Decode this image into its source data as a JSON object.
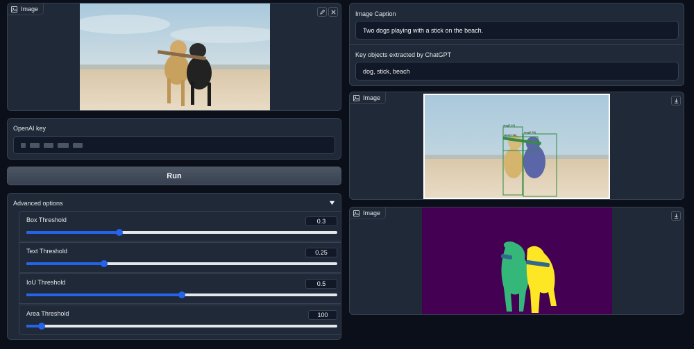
{
  "input_image": {
    "label": "Image",
    "edit_icon": "pencil-icon",
    "clear_icon": "close-icon"
  },
  "openai": {
    "label": "OpenAI key",
    "masked": true
  },
  "run_button": {
    "label": "Run"
  },
  "advanced": {
    "title": "Advanced options",
    "toggle_icon": "triangle-down-icon",
    "sliders": [
      {
        "label": "Box Threshold",
        "value": "0.3",
        "fraction": 0.3
      },
      {
        "label": "Text Threshold",
        "value": "0.25",
        "fraction": 0.25
      },
      {
        "label": "IoU Threshold",
        "value": "0.5",
        "fraction": 0.5
      },
      {
        "label": "Area Threshold",
        "value": "100",
        "fraction": 0.05
      }
    ]
  },
  "caption": {
    "label": "Image Caption",
    "value": "Two dogs playing with a stick on the beach."
  },
  "key_objects": {
    "label": "Key objects extracted by ChatGPT",
    "value": "dog, stick, beach"
  },
  "detection_output": {
    "label": "Image",
    "download_icon": "download-icon",
    "box_labels": [
      "dog(0.40)",
      "stick(0.56)",
      "dog(0.36)"
    ]
  },
  "mask_output": {
    "label": "Image",
    "download_icon": "download-icon"
  },
  "colors": {
    "primary": "#2563eb",
    "panel": "#1f2937",
    "background": "#0b0f19",
    "mask_bg": "#440154",
    "mask_green": "#35b779",
    "mask_yellow": "#fde725"
  }
}
